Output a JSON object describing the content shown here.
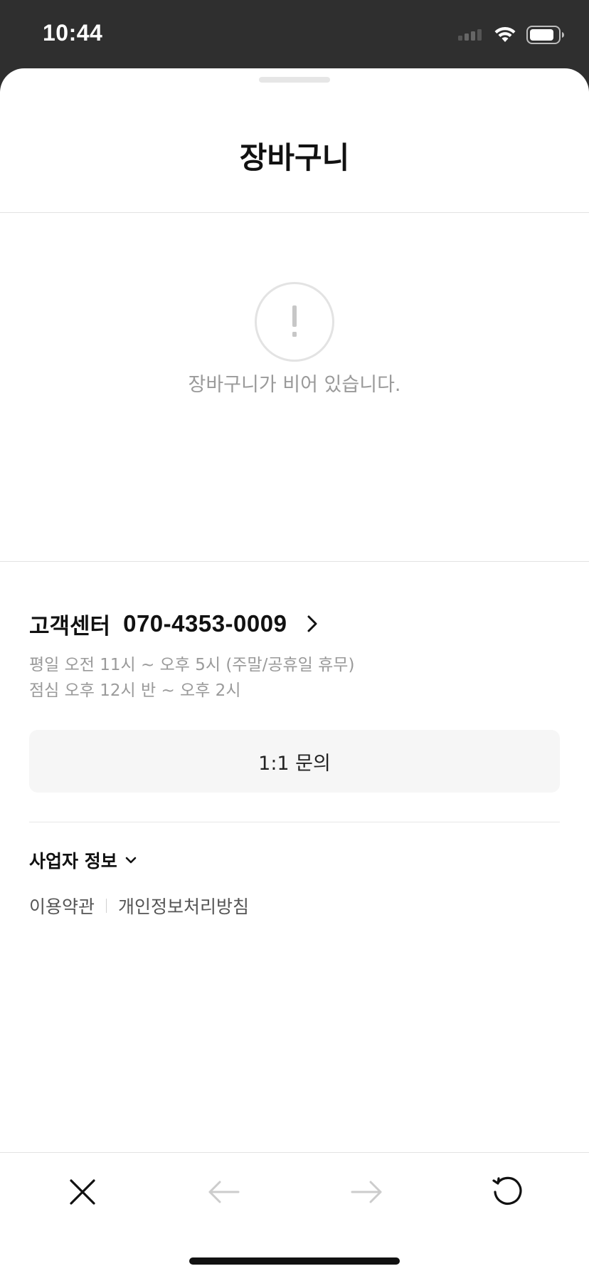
{
  "status_bar": {
    "time": "10:44"
  },
  "header": {
    "title": "장바구니"
  },
  "empty_state": {
    "icon": "exclamation-circle-icon",
    "message": "장바구니가 비어 있습니다."
  },
  "customer_center": {
    "label": "고객센터",
    "phone": "070-4353-0009",
    "hours_weekday": "평일 오전 11시 ~ 오후 5시 (주말/공휴일 휴무)",
    "hours_lunch": "점심 오후 12시 반 ~ 오후 2시",
    "inquiry_button": "1:1 문의"
  },
  "footer": {
    "business_info_label": "사업자 정보",
    "terms_link": "이용약관",
    "privacy_link": "개인정보처리방침"
  },
  "toolbar": {
    "close_icon": "close-icon",
    "back_icon": "arrow-left-icon",
    "forward_icon": "arrow-right-icon",
    "refresh_icon": "refresh-icon"
  },
  "colors": {
    "status_bar_bg": "#2f2f2f",
    "text_primary": "#111111",
    "text_muted": "#9a9a9a",
    "button_bg": "#f6f6f6",
    "disabled_icon": "#cccccc"
  }
}
